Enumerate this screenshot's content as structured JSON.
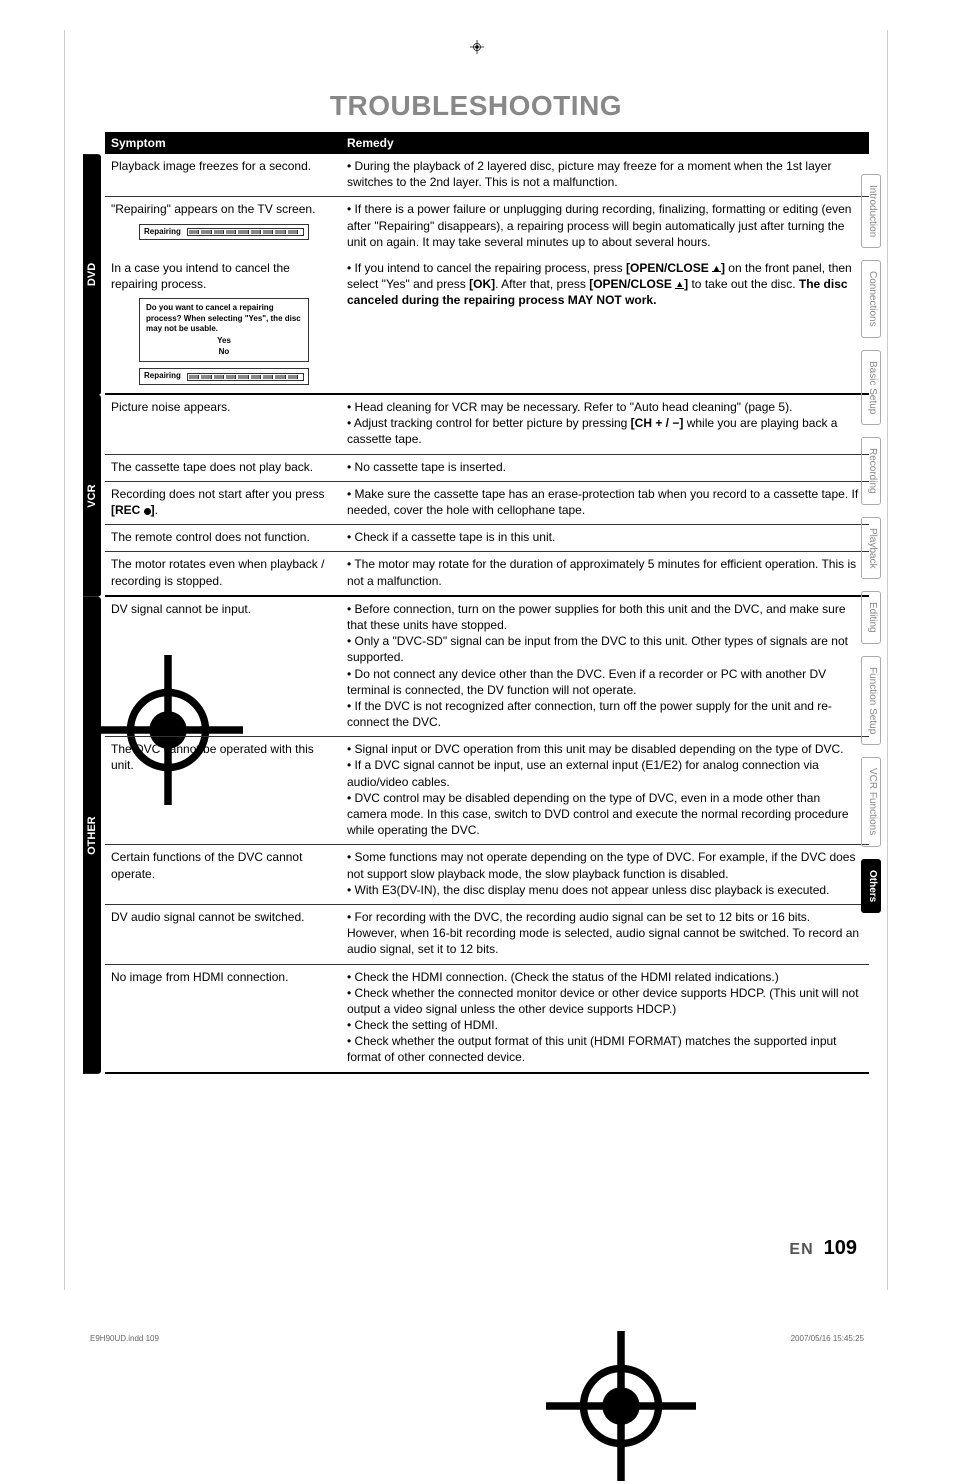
{
  "title": "TROUBLESHOOTING",
  "headers": {
    "symptom": "Symptom",
    "remedy": "Remedy"
  },
  "vtabs": {
    "dvd": "DVD",
    "vcr": "VCR",
    "other": "OTHER"
  },
  "side": {
    "intro": "Introduction",
    "conn": "Connections",
    "basic": "Basic Setup",
    "rec": "Recording",
    "play": "Playback",
    "edit": "Editing",
    "func": "Function Setup",
    "vcrf": "VCR Functions",
    "others": "Others"
  },
  "dvd": {
    "r1s": "Playback image freezes for a second.",
    "r1r": "• During the playback of 2 layered disc, picture may freeze for a moment when the 1st layer switches to the 2nd layer. This is not a malfunction.",
    "r2s": "\"Repairing\" appears on the TV screen.",
    "r2r": "• If there is a power failure or unplugging during recording, finalizing, formatting or editing (even after \"Repairing\" disappears), a repairing process will begin automatically just after turning the unit on again. It may take several minutes up to about several hours.",
    "r3s": "In a case you intend to cancel the repairing process.",
    "r3r_a": "• If you intend to cancel the repairing process, press ",
    "r3r_b": " on the front panel, then select \"Yes\" and press ",
    "r3r_c": ". After that, press ",
    "r3r_d": " to take out the disc. ",
    "r3r_e": "The disc canceled during the repairing process MAY NOT work.",
    "open": "[OPEN/CLOSE ",
    "open2": "]",
    "ok": "[OK]",
    "repair_label": "Repairing",
    "cancel_msg": "Do you want to cancel a repairing process? When selecting \"Yes\", the disc may not be usable.",
    "yes": "Yes",
    "no": "No"
  },
  "vcr": {
    "r1s": "Picture noise appears.",
    "r1r_a": "• Head cleaning for VCR may be necessary. Refer to \"Auto head cleaning\" (page 5).",
    "r1r_b": "• Adjust tracking control for better picture by pressing ",
    "r1r_c": " while you are playing back a cassette tape.",
    "ch": "[CH + / −]",
    "r2s": "The cassette tape does not play back.",
    "r2r": "• No cassette tape is inserted.",
    "r3s_a": "Recording does not start after you press ",
    "r3s_b": ".",
    "rec": "[REC ",
    "rec2": "]",
    "r3r": "• Make sure the cassette tape has an erase-protection tab when you record to a cassette tape. If needed, cover the hole with cellophane tape.",
    "r4s": "The remote control does not function.",
    "r4r": "• Check if a cassette tape is in this unit.",
    "r5s": "The motor rotates even when playback / recording is stopped.",
    "r5r": "• The motor may rotate for the duration of approximately 5 minutes for efficient operation. This is not a malfunction."
  },
  "other": {
    "r1s": "DV signal cannot be input.",
    "r1r": "• Before connection, turn on the power supplies for both this unit and the DVC, and make sure that these units have stopped.\n• Only a \"DVC-SD\" signal can be input from the DVC to this unit. Other types of signals are not supported.\n• Do not connect any device other than the DVC. Even if a recorder or PC with another DV terminal is connected, the DV function will not operate.\n• If the DVC is not recognized after connection, turn off the power supply for the unit and re-connect the DVC.",
    "r2s": "The DVC cannot be operated with this unit.",
    "r2r": "• Signal input or DVC operation from this unit may be disabled depending on the type of DVC.\n• If a DVC signal cannot be input, use an external input (E1/E2) for analog connection via audio/video cables.\n• DVC control may be disabled depending on the type of DVC, even in a mode other than camera mode. In this case, switch to DVD control and execute the normal recording procedure while operating the DVC.",
    "r3s": "Certain functions of the DVC cannot operate.",
    "r3r": "• Some functions may not operate depending on the type of DVC. For example, if the DVC does not support slow playback mode, the slow playback function is disabled.\n• With E3(DV-IN), the disc display menu does not appear unless disc playback is executed.",
    "r4s": "DV audio signal cannot be switched.",
    "r4r": "• For recording with the DVC, the recording audio signal can be set to 12 bits or 16 bits. However, when 16-bit recording mode is selected, audio signal cannot be switched. To record an audio signal, set it to 12 bits.",
    "r5s": "No image from HDMI connection.",
    "r5r": "• Check the HDMI connection. (Check the status of the HDMI related indications.)\n• Check whether the connected monitor device or other device supports HDCP. (This unit will not output a video signal unless the other device supports HDCP.)\n• Check the setting of HDMI.\n• Check whether the output format of this unit (HDMI FORMAT) matches the supported input format of other connected device."
  },
  "footer": {
    "en": "EN",
    "num": "109",
    "left": "E9H90UD.indd   109",
    "right": "2007/05/16   15:45:25"
  }
}
